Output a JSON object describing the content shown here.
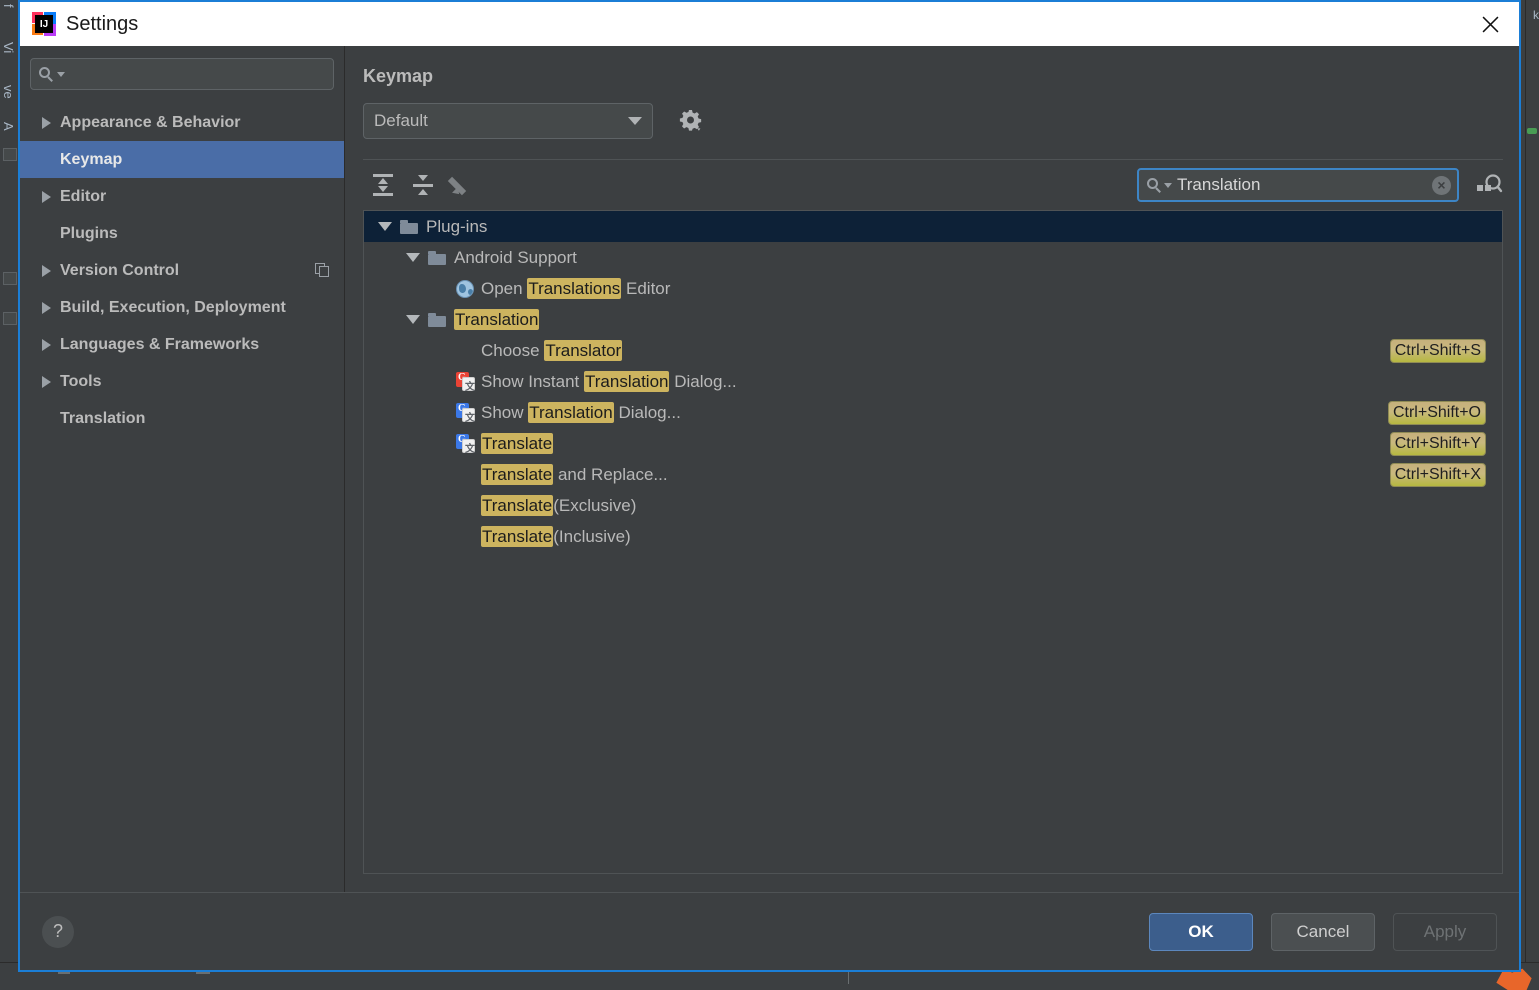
{
  "backdrop": {
    "left_labels": [
      "f",
      "Vi",
      "ve",
      "A"
    ],
    "right_label": "k"
  },
  "window": {
    "title": "Settings",
    "logo_text": "IJ",
    "close_icon": "close-icon"
  },
  "sidebar": {
    "search_placeholder": "",
    "search_icon": "search-icon",
    "items": [
      {
        "label": "Appearance & Behavior",
        "expandable": true,
        "selected": false,
        "extra_icon": null
      },
      {
        "label": "Keymap",
        "expandable": false,
        "selected": true,
        "extra_icon": null
      },
      {
        "label": "Editor",
        "expandable": true,
        "selected": false,
        "extra_icon": null
      },
      {
        "label": "Plugins",
        "expandable": false,
        "selected": false,
        "extra_icon": null
      },
      {
        "label": "Version Control",
        "expandable": true,
        "selected": false,
        "extra_icon": "copy-icon"
      },
      {
        "label": "Build, Execution, Deployment",
        "expandable": true,
        "selected": false,
        "extra_icon": null
      },
      {
        "label": "Languages & Frameworks",
        "expandable": true,
        "selected": false,
        "extra_icon": null
      },
      {
        "label": "Tools",
        "expandable": true,
        "selected": false,
        "extra_icon": null
      },
      {
        "label": "Translation",
        "expandable": false,
        "selected": false,
        "extra_icon": null
      }
    ]
  },
  "main": {
    "title": "Keymap",
    "keymap_select": {
      "value": "Default",
      "icon": "chevron-down-icon"
    },
    "gear_icon": "gear-icon",
    "toolbar": [
      {
        "name": "expand-all-icon",
        "tooltip": "Expand All"
      },
      {
        "name": "collapse-all-icon",
        "tooltip": "Collapse All"
      },
      {
        "name": "edit-shortcut-icon",
        "tooltip": "Edit Shortcut"
      }
    ],
    "tree_search": {
      "value": "Translation",
      "search_icon": "search-icon",
      "clear_icon": "clear-icon",
      "clear_glyph": "×"
    },
    "find_by_shortcut_icon": "keyboard-search-icon"
  },
  "tree": {
    "highlight_color": "#cdb45f",
    "selected_row_color": "#0d2137",
    "rows": [
      {
        "indent": 0,
        "type": "folder",
        "arrow": "down",
        "selected": true,
        "icon": null,
        "segments": [
          {
            "t": "Plug-ins",
            "h": false
          }
        ],
        "shortcut": null
      },
      {
        "indent": 1,
        "type": "folder",
        "arrow": "down",
        "selected": false,
        "icon": null,
        "segments": [
          {
            "t": "Android Support",
            "h": false
          }
        ],
        "shortcut": null
      },
      {
        "indent": 2,
        "type": "action",
        "arrow": "none",
        "selected": false,
        "icon": "globe-icon",
        "segments": [
          {
            "t": "Open ",
            "h": false
          },
          {
            "t": "Translations",
            "h": true
          },
          {
            "t": " Editor",
            "h": false
          }
        ],
        "shortcut": null
      },
      {
        "indent": 1,
        "type": "folder",
        "arrow": "down",
        "selected": false,
        "icon": null,
        "segments": [
          {
            "t": "Translation",
            "h": true
          }
        ],
        "shortcut": null
      },
      {
        "indent": 2,
        "type": "action",
        "arrow": "none",
        "selected": false,
        "icon": null,
        "segments": [
          {
            "t": "Choose ",
            "h": false
          },
          {
            "t": "Translator",
            "h": true
          }
        ],
        "shortcut": "Ctrl+Shift+S"
      },
      {
        "indent": 2,
        "type": "action",
        "arrow": "none",
        "selected": false,
        "icon": "google-translate-red-icon",
        "segments": [
          {
            "t": "Show Instant ",
            "h": false
          },
          {
            "t": "Translation",
            "h": true
          },
          {
            "t": " Dialog...",
            "h": false
          }
        ],
        "shortcut": null
      },
      {
        "indent": 2,
        "type": "action",
        "arrow": "none",
        "selected": false,
        "icon": "google-translate-blue-icon",
        "segments": [
          {
            "t": "Show ",
            "h": false
          },
          {
            "t": "Translation",
            "h": true
          },
          {
            "t": " Dialog...",
            "h": false
          }
        ],
        "shortcut": "Ctrl+Shift+O"
      },
      {
        "indent": 2,
        "type": "action",
        "arrow": "none",
        "selected": false,
        "icon": "google-translate-blue-icon",
        "segments": [
          {
            "t": "Translate",
            "h": true
          }
        ],
        "shortcut": "Ctrl+Shift+Y"
      },
      {
        "indent": 2,
        "type": "action",
        "arrow": "none",
        "selected": false,
        "icon": null,
        "segments": [
          {
            "t": "Translate",
            "h": true
          },
          {
            "t": " and Replace...",
            "h": false
          }
        ],
        "shortcut": "Ctrl+Shift+X"
      },
      {
        "indent": 2,
        "type": "action",
        "arrow": "none",
        "selected": false,
        "icon": null,
        "segments": [
          {
            "t": "Translate",
            "h": true
          },
          {
            "t": "(Exclusive)",
            "h": false
          }
        ],
        "shortcut": null
      },
      {
        "indent": 2,
        "type": "action",
        "arrow": "none",
        "selected": false,
        "icon": null,
        "segments": [
          {
            "t": "Translate",
            "h": true
          },
          {
            "t": "(Inclusive)",
            "h": false
          }
        ],
        "shortcut": null
      }
    ]
  },
  "footer": {
    "help_glyph": "?",
    "buttons": [
      {
        "label": "OK",
        "style": "primary"
      },
      {
        "label": "Cancel",
        "style": "normal"
      },
      {
        "label": "Apply",
        "style": "disabled"
      }
    ]
  }
}
